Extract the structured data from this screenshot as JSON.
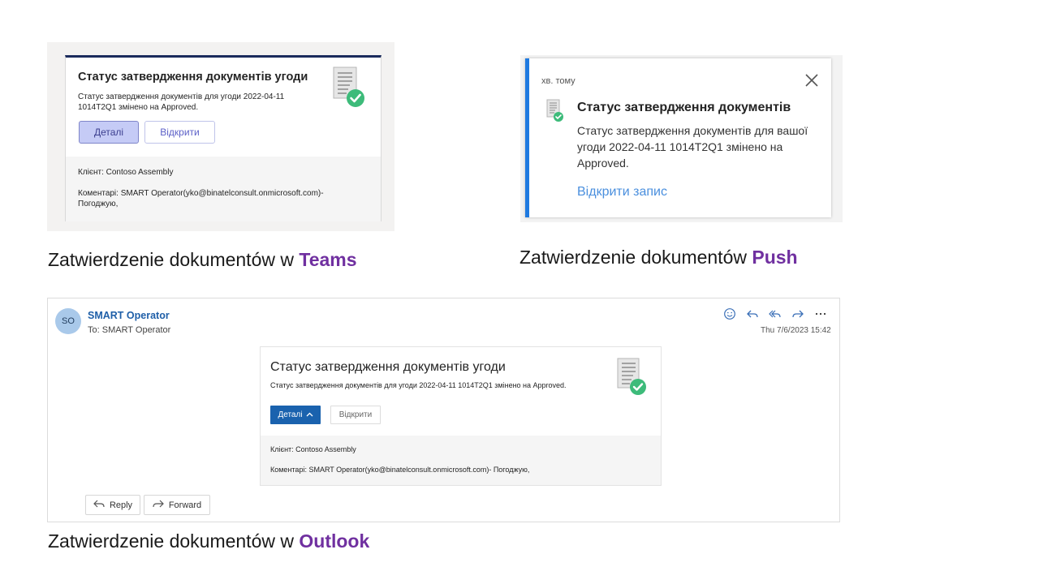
{
  "teams": {
    "title": "Статус затвердження документів угоди",
    "body": "Статус затвердження документів для угоди 2022-04-11 1014T2Q1 змінено на Approved.",
    "details_label": "Деталі",
    "open_label": "Відкрити",
    "client": "Клієнт: Contoso Assembly",
    "comment": "Коментарі: SMART Operator(yko@binatelconsult.onmicrosoft.com)- Погоджую,",
    "icon": "document-check-icon"
  },
  "push": {
    "time": "хв. тому",
    "title": "Статус затвердження документів",
    "body": "Статус затвердження документів для вашої угоди 2022-04-11 1014T2Q1 змінено на Approved.",
    "link": "Відкрити запис",
    "accent": "#1f7ae0"
  },
  "captions": {
    "teams_prefix": "Zatwierdzenie dokumentów w ",
    "teams_bold": "Teams",
    "push_prefix": "Zatwierdzenie dokumentów ",
    "push_bold": "Push",
    "outlook_prefix": "Zatwierdzenie dokumentów w ",
    "outlook_bold": "Outlook",
    "accent": "#7030a0"
  },
  "outlook": {
    "avatar": "SO",
    "sender": "SMART Operator",
    "to": "To:  SMART Operator",
    "date": "Thu 7/6/2023 15:42",
    "card_title": "Статус затвердження документів угоди",
    "card_body": "Статус затвердження документів для угоди 2022-04-11 1014T2Q1 змінено на Approved.",
    "details_label": "Деталі",
    "open_label": "Відкрити",
    "client": "Клієнт: Contoso Assembly",
    "comment": "Коментарі: SMART Operator(yko@binatelconsult.onmicrosoft.com)- Погоджую,",
    "reply_label": "Reply",
    "forward_label": "Forward",
    "accent": "#1a62ae"
  }
}
